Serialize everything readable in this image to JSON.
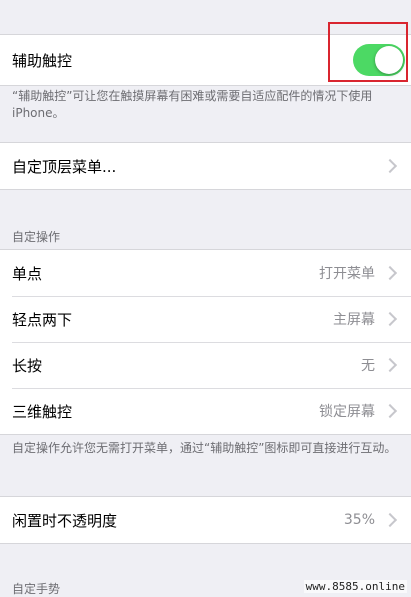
{
  "assistive_touch": {
    "label": "辅助触控",
    "enabled": true,
    "note": "“辅助触控”可让您在触摸屏幕有困难或需要自适应配件的情况下使用 iPhone。"
  },
  "customize_menu": {
    "label": "自定顶层菜单..."
  },
  "custom_actions": {
    "header": "自定操作",
    "rows": [
      {
        "label": "单点",
        "value": "打开菜单"
      },
      {
        "label": "轻点两下",
        "value": "主屏幕"
      },
      {
        "label": "长按",
        "value": "无"
      },
      {
        "label": "三维触控",
        "value": "锁定屏幕"
      }
    ],
    "note": "自定操作允许您无需打开菜单，通过“辅助触控”图标即可直接进行互动。"
  },
  "idle_opacity": {
    "label": "闲置时不透明度",
    "value": "35%"
  },
  "custom_gestures": {
    "header": "自定手势"
  },
  "watermark": "www.8585.online",
  "colors": {
    "toggle_on": "#4cd964",
    "highlight": "#d9252f",
    "background": "#efeff4"
  }
}
